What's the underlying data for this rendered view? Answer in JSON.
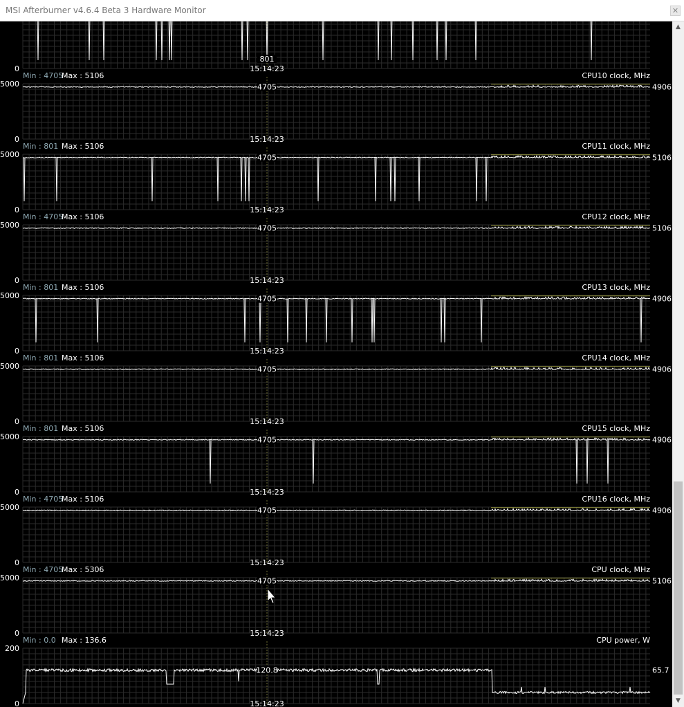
{
  "window": {
    "title": "MSI Afterburner v4.6.4 Beta 3 Hardware Monitor",
    "close_glyph": "✕",
    "scroll_up_glyph": "▲",
    "scroll_down_glyph": "▼"
  },
  "colors": {
    "background": "#000000",
    "grid": "#2b2b2b",
    "trace": "#ffffff",
    "trace_tail": "#c8c84a",
    "text": "#ffffff",
    "min_label": "#8fa9b3",
    "cursor_line": "#6b6b33"
  },
  "cursor_time": "15:14:23",
  "graphs": [
    {
      "id": "cpu9",
      "partial": true,
      "title": "",
      "min_label": "",
      "max_label": "",
      "y_top": "",
      "y_bottom": "0",
      "current_value": "",
      "cursor_value": "801",
      "baseline": 5000,
      "ymax": 5200,
      "dips": [
        55,
        129,
        150,
        226,
        234,
        245,
        248,
        350,
        358,
        386,
        467,
        547,
        566,
        597,
        632,
        645,
        688,
        855
      ]
    },
    {
      "id": "cpu10",
      "title": "CPU10 clock, MHz",
      "min_label": "Min : 4705",
      "max_label": "Max : 5106",
      "y_top": "5000",
      "y_bottom": "0",
      "current_value": "4906",
      "cursor_value": "4705",
      "baseline": 4705,
      "ymax": 5000,
      "dips": []
    },
    {
      "id": "cpu11",
      "title": "CPU11 clock, MHz",
      "min_label": "Min : 801",
      "max_label": "Max : 5106",
      "y_top": "5000",
      "y_bottom": "0",
      "current_value": "5106",
      "cursor_value": "4705",
      "baseline": 4705,
      "ymax": 5000,
      "dips": [
        35,
        82,
        220,
        315,
        349,
        355,
        360,
        460,
        543,
        565,
        571,
        606,
        689,
        703
      ]
    },
    {
      "id": "cpu12",
      "title": "CPU12 clock, MHz",
      "min_label": "Min : 4705",
      "max_label": "Max : 5106",
      "y_top": "5000",
      "y_bottom": "0",
      "current_value": "5106",
      "cursor_value": "4705",
      "baseline": 4705,
      "ymax": 5000,
      "dips": []
    },
    {
      "id": "cpu13",
      "title": "CPU13 clock, MHz",
      "min_label": "Min : 801",
      "max_label": "Max : 5106",
      "y_top": "5000",
      "y_bottom": "0",
      "current_value": "4906",
      "cursor_value": "4705",
      "baseline": 4705,
      "ymax": 5000,
      "dips": [
        52,
        141,
        354,
        376,
        416,
        443,
        472,
        509,
        538,
        541,
        638,
        643,
        696,
        927
      ]
    },
    {
      "id": "cpu14",
      "title": "CPU14 clock, MHz",
      "min_label": "Min : 801",
      "max_label": "Max : 5106",
      "y_top": "5000",
      "y_bottom": "0",
      "current_value": "4906",
      "cursor_value": "4705",
      "baseline": 4705,
      "ymax": 5000,
      "dips": []
    },
    {
      "id": "cpu15",
      "title": "CPU15 clock, MHz",
      "min_label": "Min : 801",
      "max_label": "Max : 5106",
      "y_top": "5000",
      "y_bottom": "0",
      "current_value": "4906",
      "cursor_value": "4705",
      "baseline": 4705,
      "ymax": 5000,
      "dips": [
        304,
        453,
        834,
        849,
        879
      ]
    },
    {
      "id": "cpu16",
      "title": "CPU16 clock, MHz",
      "min_label": "Min : 4705",
      "max_label": "Max : 5106",
      "y_top": "5000",
      "y_bottom": "0",
      "current_value": "4906",
      "cursor_value": "4705",
      "baseline": 4705,
      "ymax": 5000,
      "dips": []
    },
    {
      "id": "cpu",
      "title": "CPU clock, MHz",
      "min_label": "Min : 4705",
      "max_label": "Max : 5306",
      "y_top": "5000",
      "y_bottom": "0",
      "current_value": "5106",
      "cursor_value": "4705",
      "baseline": 4705,
      "ymax": 5000,
      "dips": []
    },
    {
      "id": "power",
      "title": "CPU power, W",
      "min_label": "Min : 0.0",
      "max_label": "Max : 136.6",
      "y_top": "200",
      "y_bottom": "0",
      "current_value": "65.7",
      "cursor_value": "120.8",
      "baseline": 120.8,
      "ymax": 200,
      "power": true,
      "dips": []
    }
  ]
}
